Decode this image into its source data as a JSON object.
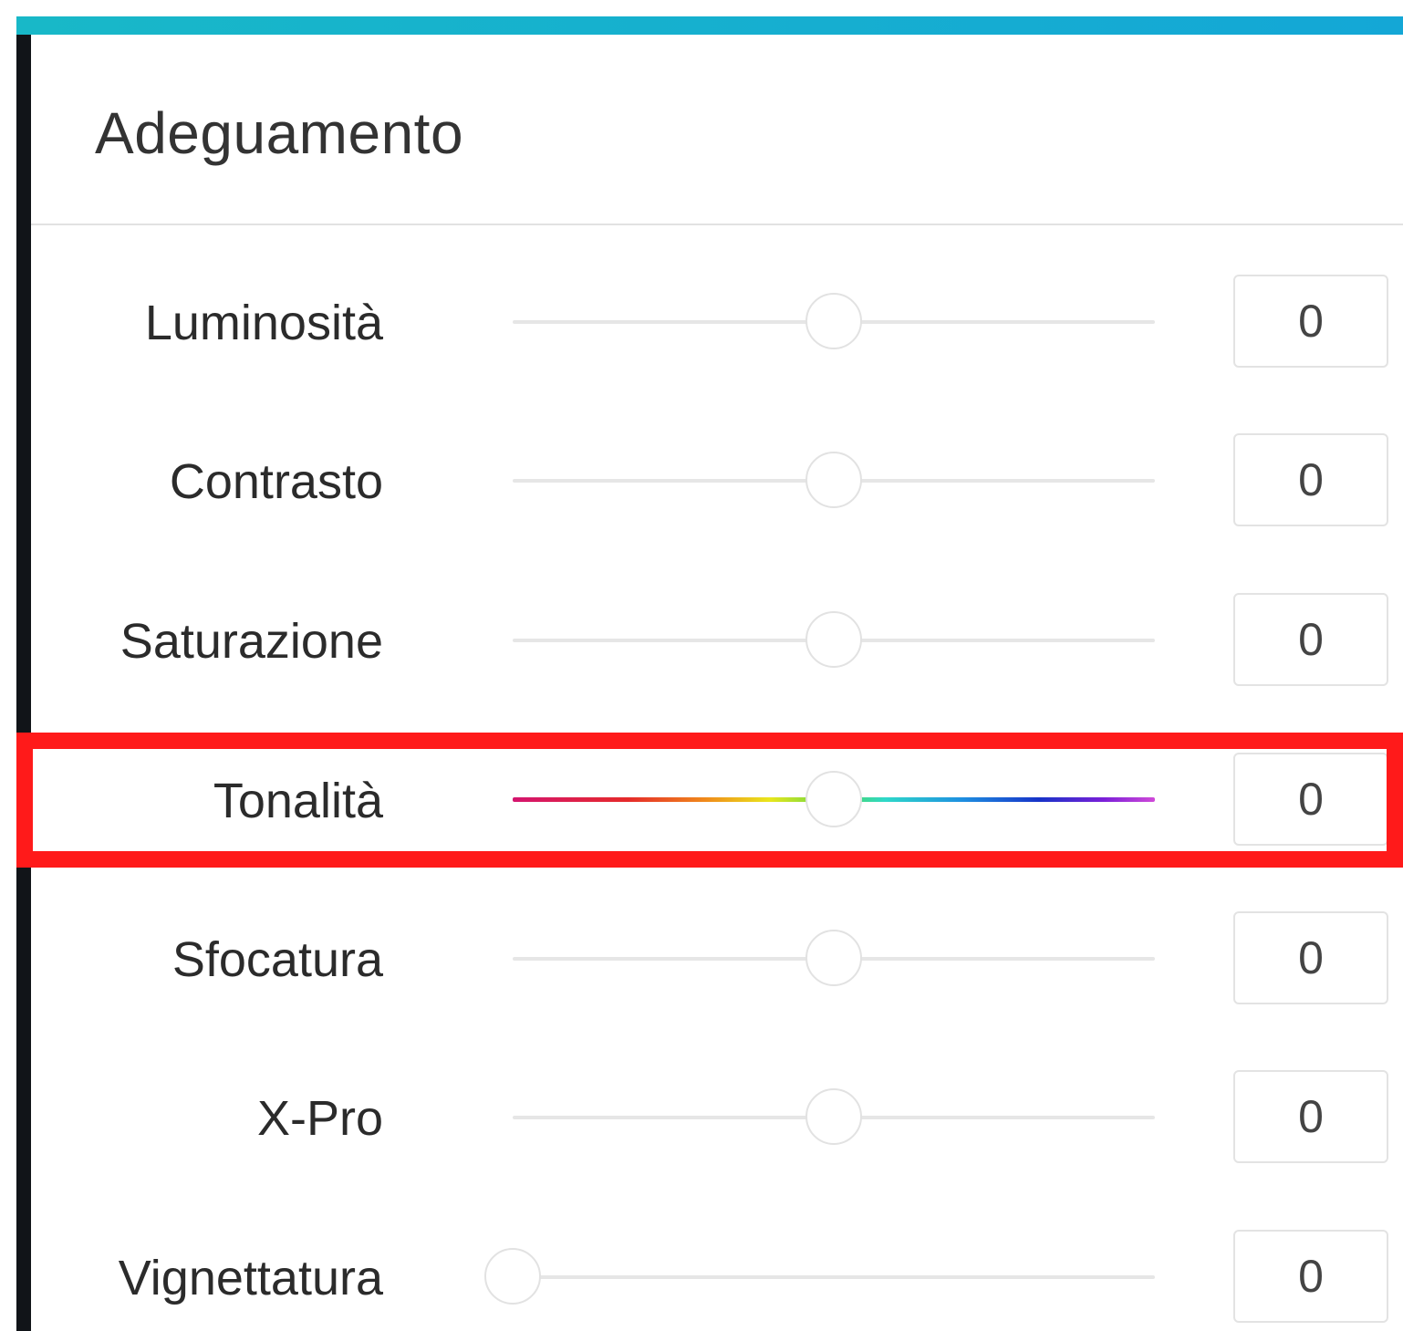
{
  "panel": {
    "title": "Adeguamento",
    "accent_color": "#14a7d6",
    "highlight_color": "#ff1a1a"
  },
  "sliders": [
    {
      "id": "luminosita",
      "label": "Luminosità",
      "value": "0",
      "position_fraction": 0.5,
      "track": "plain"
    },
    {
      "id": "contrasto",
      "label": "Contrasto",
      "value": "0",
      "position_fraction": 0.5,
      "track": "plain"
    },
    {
      "id": "saturazione",
      "label": "Saturazione",
      "value": "0",
      "position_fraction": 0.5,
      "track": "plain"
    },
    {
      "id": "tonalita",
      "label": "Tonalità",
      "value": "0",
      "position_fraction": 0.5,
      "track": "hue-spectrum",
      "highlighted": true
    },
    {
      "id": "sfocatura",
      "label": "Sfocatura",
      "value": "0",
      "position_fraction": 0.5,
      "track": "plain"
    },
    {
      "id": "x-pro",
      "label": "X-Pro",
      "value": "0",
      "position_fraction": 0.5,
      "track": "plain"
    },
    {
      "id": "vignettatura",
      "label": "Vignettatura",
      "value": "0",
      "position_fraction": 0.0,
      "track": "plain"
    }
  ]
}
